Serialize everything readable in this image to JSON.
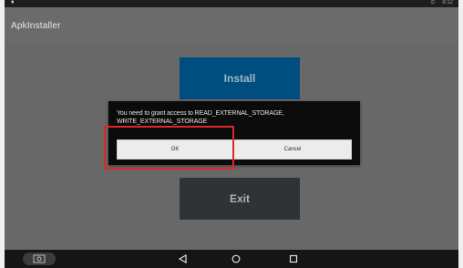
{
  "status_bar": {
    "time": "8:12"
  },
  "app": {
    "title": "ApkInstaller"
  },
  "main": {
    "install_label": "Install",
    "exit_label": "Exit"
  },
  "dialog": {
    "message": "You need to grant access to READ_EXTERNAL_STORAGE, WRITE_EXTERNAL_STORAGE",
    "ok_label": "OK",
    "cancel_label": "Cancel"
  },
  "nav": {
    "icons": [
      "screenshot-icon",
      "back-icon",
      "home-icon",
      "recents-icon"
    ]
  },
  "colors": {
    "install_button": "#004d80",
    "exit_button": "#2f3336",
    "highlight": "#e0262a"
  }
}
